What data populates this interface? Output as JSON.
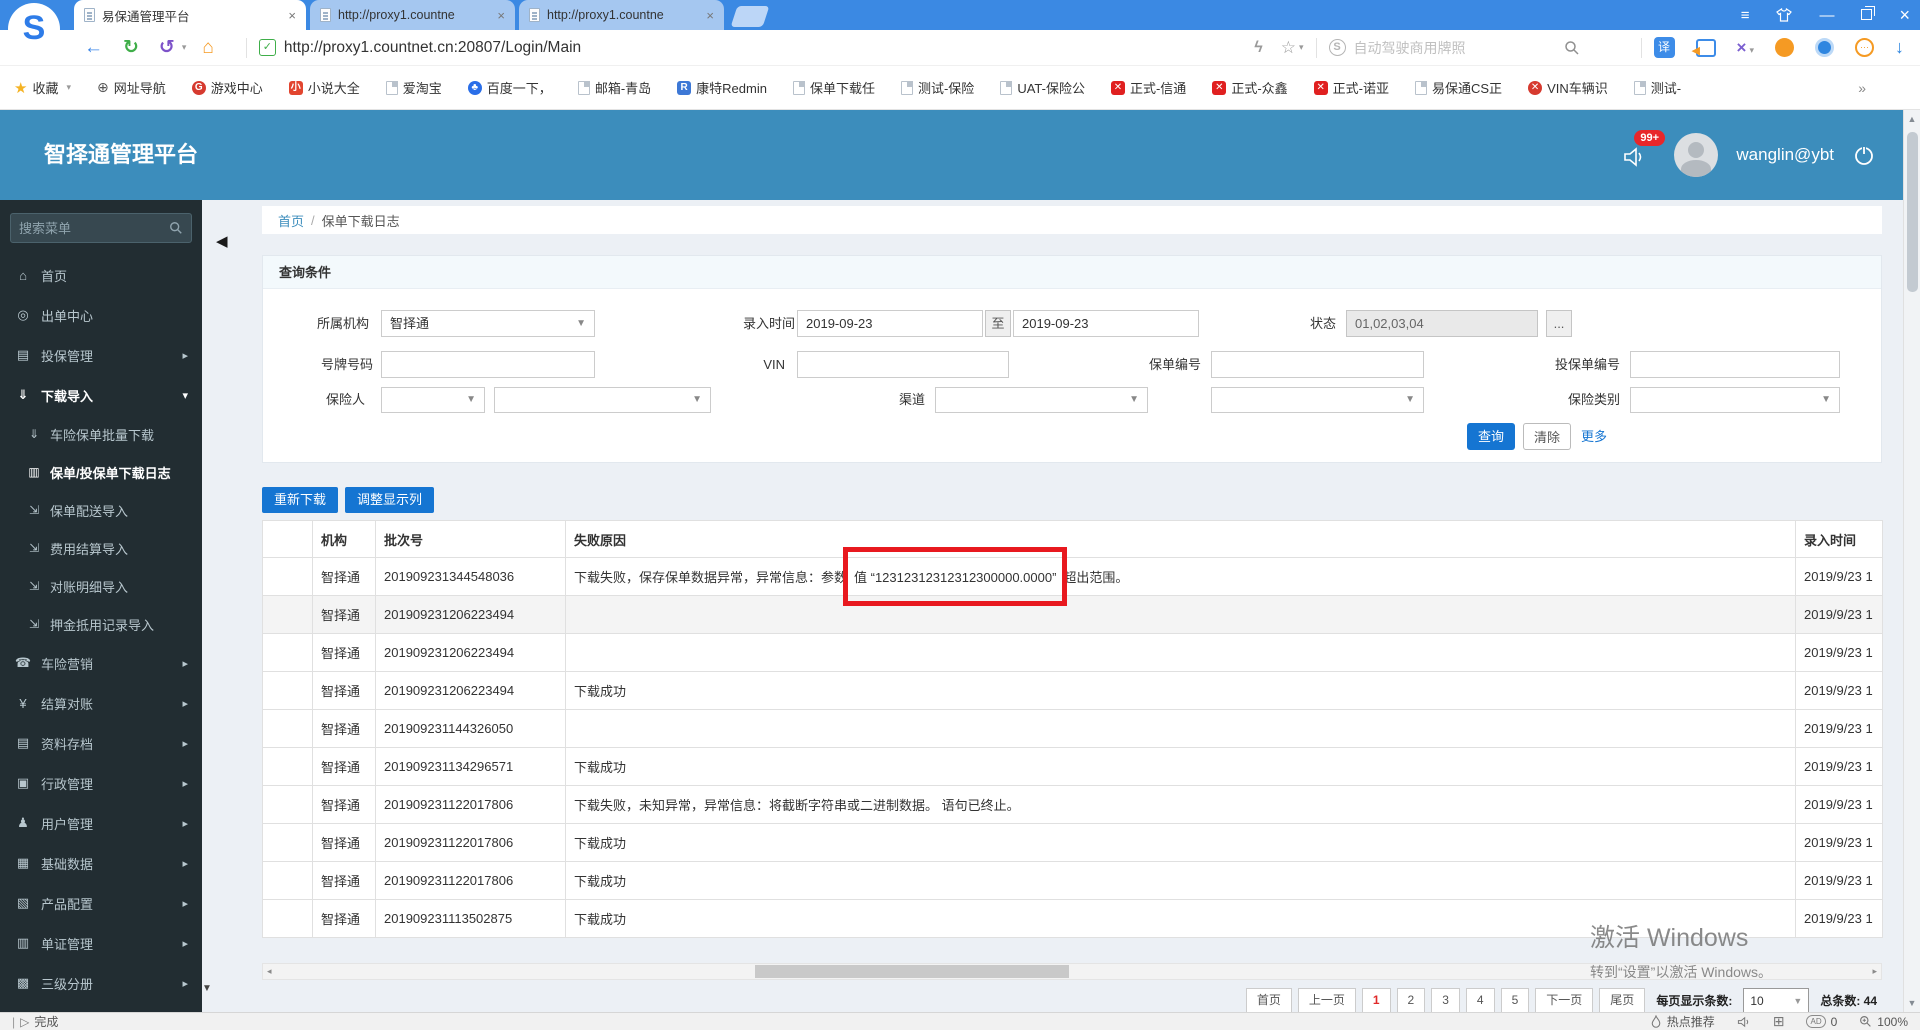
{
  "browser": {
    "window": {
      "menu_icon": "≡",
      "min_icon": "—",
      "close_icon": "×"
    },
    "tabs": [
      {
        "title": "易保通管理平台",
        "close": "×"
      },
      {
        "title": "http://proxy1.countne",
        "close": "×"
      },
      {
        "title": "http://proxy1.countne",
        "close": "×"
      }
    ],
    "toolbar": {
      "back_icon": "←",
      "refresh_icon": "↻",
      "undo_icon": "↺",
      "home_icon": "⌂",
      "shield_check": "✓",
      "url": "http://proxy1.countnet.cn:20807/Login/Main",
      "bolt_icon": "ϟ",
      "star_icon": "☆",
      "sogou_s": "S",
      "search_placeholder": "自动驾驶商用牌照",
      "translate_icon": "译",
      "x_icon": "×",
      "down_icon": "↓"
    },
    "bookmarks": [
      {
        "label": "收藏"
      },
      {
        "label": "网址导航"
      },
      {
        "label": "游戏中心"
      },
      {
        "label": "小说大全"
      },
      {
        "label": "爱淘宝"
      },
      {
        "label": "百度一下，"
      },
      {
        "label": "邮箱-青岛"
      },
      {
        "label": "康特Redmin"
      },
      {
        "label": "保单下载任"
      },
      {
        "label": "测试-保险"
      },
      {
        "label": "UAT-保险公"
      },
      {
        "label": "正式-信通"
      },
      {
        "label": "正式-众鑫"
      },
      {
        "label": "正式-诺亚"
      },
      {
        "label": "易保通CS正"
      },
      {
        "label": "VIN车辆识"
      },
      {
        "label": "测试-"
      }
    ],
    "bookmarks_overflow": "»",
    "statusbar": {
      "done": "完成",
      "hotspot": "热点推荐",
      "ad_count": "0",
      "zoom_level": "100%"
    }
  },
  "app": {
    "header": {
      "title": "智择通管理平台",
      "badge": "99+",
      "user": "wanglin@ybt"
    },
    "sidebar": {
      "search_placeholder": "搜索菜单",
      "top": [
        {
          "label": "首页"
        },
        {
          "label": "出单中心"
        },
        {
          "label": "投保管理"
        },
        {
          "label": "下载导入"
        }
      ],
      "submenu": [
        {
          "label": "车险保单批量下载"
        },
        {
          "label": "保单/投保单下载日志"
        },
        {
          "label": "保单配送导入"
        },
        {
          "label": "费用结算导入"
        },
        {
          "label": "对账明细导入"
        },
        {
          "label": "押金抵用记录导入"
        }
      ],
      "bottom": [
        {
          "label": "车险营销"
        },
        {
          "label": "结算对账"
        },
        {
          "label": "资料存档"
        },
        {
          "label": "行政管理"
        },
        {
          "label": "用户管理"
        },
        {
          "label": "基础数据"
        },
        {
          "label": "产品配置"
        },
        {
          "label": "单证管理"
        },
        {
          "label": "三级分册"
        }
      ]
    },
    "breadcrumb": {
      "home": "首页",
      "sep": "/",
      "current": "保单下载日志"
    },
    "query": {
      "title": "查询条件",
      "org_label": "所属机构",
      "org_value": "智择通",
      "time_label": "录入时间",
      "date_from": "2019-09-23",
      "date_sep": "至",
      "date_to": "2019-09-23",
      "status_label": "状态",
      "status_value": "01,02,03,04",
      "status_more": "...",
      "plate_label": "号牌号码",
      "vin_label": "VIN",
      "policy_label": "保单编号",
      "proposal_label": "投保单编号",
      "insurer_label": "保险人",
      "channel_label": "渠道",
      "instype_label": "保险类别",
      "search_btn": "查询",
      "clear_btn": "清除",
      "more_btn": "更多"
    },
    "actions": {
      "redownload": "重新下载",
      "adjust": "调整显示列"
    },
    "table": {
      "headers": {
        "org": "机构",
        "batch": "批次号",
        "reason": "失败原因",
        "time": "录入时间"
      },
      "rows": [
        {
          "org": "智择通",
          "batch": "201909231344548036",
          "reason_pre": "下载失败，保存保单数据异常，异常信息：参数",
          "reason_boxed": "值 “12312312312312300000.0000”",
          "reason_post": "超出范围。",
          "time": "2019/9/23 1"
        },
        {
          "org": "智择通",
          "batch": "201909231206223494",
          "reason": "",
          "time": "2019/9/23 1"
        },
        {
          "org": "智择通",
          "batch": "201909231206223494",
          "reason": "",
          "time": "2019/9/23 1"
        },
        {
          "org": "智择通",
          "batch": "201909231206223494",
          "reason": "下载成功",
          "time": "2019/9/23 1"
        },
        {
          "org": "智择通",
          "batch": "201909231144326050",
          "reason": "",
          "time": "2019/9/23 1"
        },
        {
          "org": "智择通",
          "batch": "201909231134296571",
          "reason": "下载成功",
          "time": "2019/9/23 1"
        },
        {
          "org": "智择通",
          "batch": "201909231122017806",
          "reason": "下载失败，未知异常，异常信息：将截断字符串或二进制数据。 语句已终止。",
          "time": "2019/9/23 1"
        },
        {
          "org": "智择通",
          "batch": "201909231122017806",
          "reason": "下载成功",
          "time": "2019/9/23 1"
        },
        {
          "org": "智择通",
          "batch": "201909231122017806",
          "reason": "下载成功",
          "time": "2019/9/23 1"
        },
        {
          "org": "智择通",
          "batch": "201909231113502875",
          "reason": "下载成功",
          "time": "2019/9/23 1"
        }
      ]
    },
    "pagination": {
      "first": "首页",
      "prev": "上一页",
      "pages": [
        "1",
        "2",
        "3",
        "4",
        "5"
      ],
      "next": "下一页",
      "last": "尾页",
      "per_page_label": "每页显示条数:",
      "per_page": "10",
      "total_label": "总条数: 44"
    },
    "watermark": {
      "line1": "激活 Windows",
      "line2": "转到“设置”以激活 Windows。"
    }
  },
  "colors": {
    "tab_blue": "#3b89e3",
    "header_teal": "#3c8dbc",
    "sidebar_dark": "#222d32",
    "accent_blue": "#1575d2",
    "annotation_red": "#e8191f",
    "badge_red": "#e8262a",
    "link_blue": "#3c8dbc"
  }
}
